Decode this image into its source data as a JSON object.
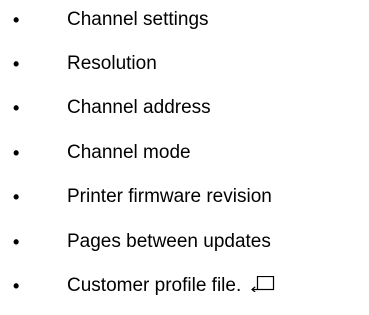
{
  "list": {
    "bullet_glyph": "•",
    "items": [
      "Channel settings",
      "Resolution",
      "Channel address",
      "Channel mode",
      "Printer firmware revision",
      "Pages between updates",
      "Customer profile file."
    ],
    "end_mark_icon": "return-arrow-box-icon"
  }
}
